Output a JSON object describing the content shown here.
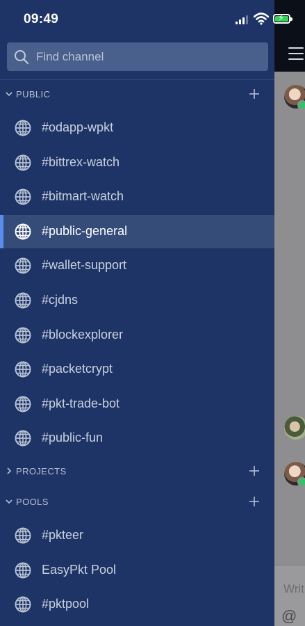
{
  "status_bar": {
    "time": "09:49"
  },
  "search": {
    "placeholder": "Find channel"
  },
  "sections": {
    "public": {
      "title": "PUBLIC"
    },
    "projects": {
      "title": "PROJECTS"
    },
    "pools": {
      "title": "POOLS"
    }
  },
  "public_channels": [
    {
      "label": "#odapp-wpkt"
    },
    {
      "label": "#bittrex-watch"
    },
    {
      "label": "#bitmart-watch"
    },
    {
      "label": "#public-general"
    },
    {
      "label": "#wallet-support"
    },
    {
      "label": "#cjdns"
    },
    {
      "label": "#blockexplorer"
    },
    {
      "label": "#packetcrypt"
    },
    {
      "label": "#pkt-trade-bot"
    },
    {
      "label": "#public-fun"
    }
  ],
  "pool_channels": [
    {
      "label": "#pkteer"
    },
    {
      "label": "EasyPkt Pool"
    },
    {
      "label": "#pktpool"
    }
  ],
  "active_channel": "#public-general",
  "peek": {
    "compose_placeholder": "Writ",
    "compose_at": "@"
  },
  "colors": {
    "drawer_bg": "#1e3466",
    "active_row_bg": "#354b78",
    "active_indicator": "#5b8df0",
    "search_bg": "#48608b"
  }
}
